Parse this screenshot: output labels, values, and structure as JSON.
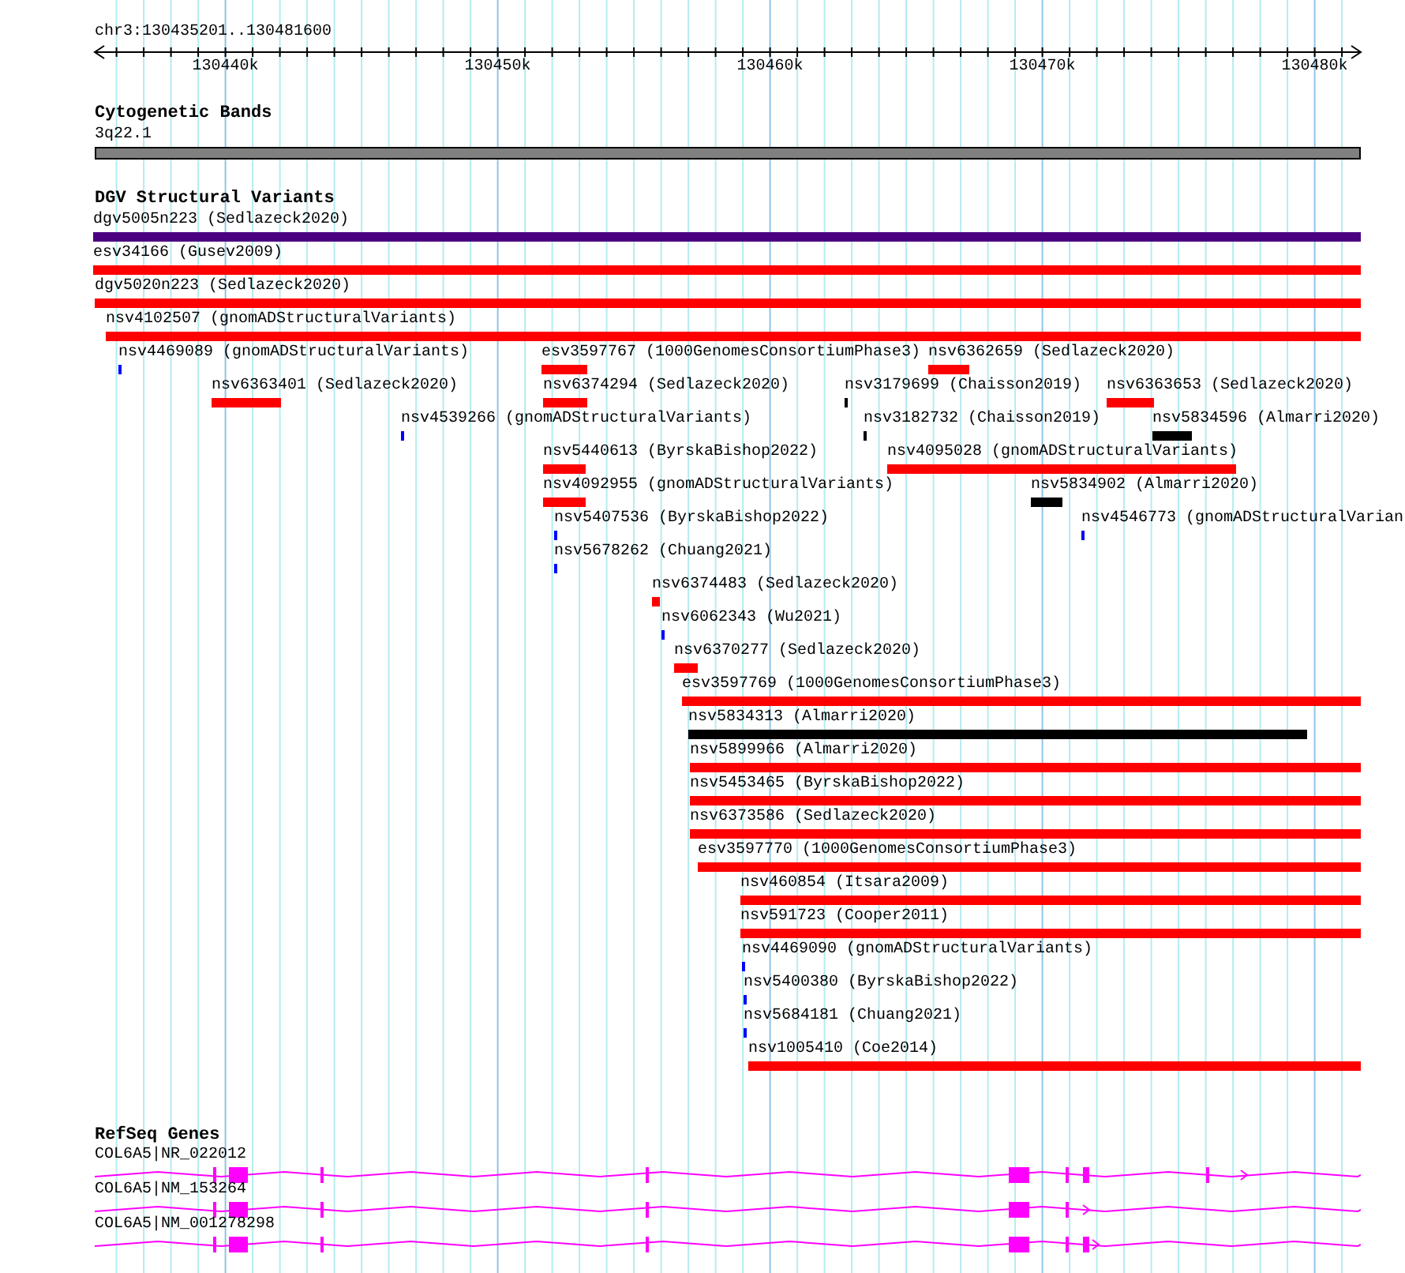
{
  "ruler": {
    "locus": "chr3:130435201..130481600",
    "ticks": [
      "130440k",
      "130450k",
      "130460k",
      "130470k",
      "130480k"
    ]
  },
  "cytogenetic_bands": {
    "title": "Cytogenetic Bands",
    "band": "3q22.1"
  },
  "dgv_structural_variants": {
    "title": "DGV Structural Variants",
    "rows": [
      {
        "features": [
          {
            "label": "dgv5005n223 (Sedlazeck2020)",
            "color": "#4b0082"
          }
        ]
      },
      {
        "features": [
          {
            "label": "esv34166 (Gusev2009)",
            "color": "#ff0000"
          }
        ]
      },
      {
        "features": [
          {
            "label": "dgv5020n223 (Sedlazeck2020)",
            "color": "#ff0000"
          }
        ]
      },
      {
        "features": [
          {
            "label": "nsv4102507 (gnomADStructuralVariants)",
            "color": "#ff0000"
          }
        ]
      },
      {
        "features": [
          {
            "label": "nsv4469089 (gnomADStructuralVariants)",
            "color": "#0000ff"
          },
          {
            "label": "esv3597767 (1000GenomesConsortiumPhase3)",
            "color": "#ff0000"
          },
          {
            "label": "nsv6362659 (Sedlazeck2020)",
            "color": "#ff0000"
          }
        ]
      },
      {
        "features": [
          {
            "label": "nsv6363401 (Sedlazeck2020)",
            "color": "#ff0000"
          },
          {
            "label": "nsv6374294 (Sedlazeck2020)",
            "color": "#ff0000"
          },
          {
            "label": "nsv3179699 (Chaisson2019)",
            "color": "#000000"
          },
          {
            "label": "nsv6363653 (Sedlazeck2020)",
            "color": "#ff0000"
          }
        ]
      },
      {
        "features": [
          {
            "label": "nsv4539266 (gnomADStructuralVariants)",
            "color": "#0000ff"
          },
          {
            "label": "nsv3182732 (Chaisson2019)",
            "color": "#000000"
          },
          {
            "label": "nsv5834596 (Almarri2020)",
            "color": "#000000"
          }
        ]
      },
      {
        "features": [
          {
            "label": "nsv5440613 (ByrskaBishop2022)",
            "color": "#ff0000"
          },
          {
            "label": "nsv4095028 (gnomADStructuralVariants)",
            "color": "#ff0000"
          }
        ]
      },
      {
        "features": [
          {
            "label": "nsv4092955 (gnomADStructuralVariants)",
            "color": "#ff0000"
          },
          {
            "label": "nsv5834902 (Almarri2020)",
            "color": "#000000"
          }
        ]
      },
      {
        "features": [
          {
            "label": "nsv5407536 (ByrskaBishop2022)",
            "color": "#0000ff"
          },
          {
            "label": "nsv4546773 (gnomADStructuralVarian",
            "color": "#0000ff"
          }
        ]
      },
      {
        "features": [
          {
            "label": "nsv5678262 (Chuang2021)",
            "color": "#0000ff"
          }
        ]
      },
      {
        "features": [
          {
            "label": "nsv6374483 (Sedlazeck2020)",
            "color": "#ff0000"
          }
        ]
      },
      {
        "features": [
          {
            "label": "nsv6062343 (Wu2021)",
            "color": "#0000ff"
          }
        ]
      },
      {
        "features": [
          {
            "label": "nsv6370277 (Sedlazeck2020)",
            "color": "#ff0000"
          }
        ]
      },
      {
        "features": [
          {
            "label": "esv3597769 (1000GenomesConsortiumPhase3)",
            "color": "#ff0000"
          }
        ]
      },
      {
        "features": [
          {
            "label": "nsv5834313 (Almarri2020)",
            "color": "#000000"
          }
        ]
      },
      {
        "features": [
          {
            "label": "nsv5899966 (Almarri2020)",
            "color": "#ff0000"
          }
        ]
      },
      {
        "features": [
          {
            "label": "nsv5453465 (ByrskaBishop2022)",
            "color": "#ff0000"
          }
        ]
      },
      {
        "features": [
          {
            "label": "nsv6373586 (Sedlazeck2020)",
            "color": "#ff0000"
          }
        ]
      },
      {
        "features": [
          {
            "label": "esv3597770 (1000GenomesConsortiumPhase3)",
            "color": "#ff0000"
          }
        ]
      },
      {
        "features": [
          {
            "label": "nsv460854 (Itsara2009)",
            "color": "#ff0000"
          }
        ]
      },
      {
        "features": [
          {
            "label": "nsv591723 (Cooper2011)",
            "color": "#ff0000"
          }
        ]
      },
      {
        "features": [
          {
            "label": "nsv4469090 (gnomADStructuralVariants)",
            "color": "#0000ff"
          }
        ]
      },
      {
        "features": [
          {
            "label": "nsv5400380 (ByrskaBishop2022)",
            "color": "#0000ff"
          }
        ]
      },
      {
        "features": [
          {
            "label": "nsv5684181 (Chuang2021)",
            "color": "#0000ff"
          }
        ]
      },
      {
        "features": [
          {
            "label": "nsv1005410 (Coe2014)",
            "color": "#ff0000"
          }
        ]
      }
    ]
  },
  "refseq_genes": {
    "title": "RefSeq Genes",
    "transcripts": [
      {
        "label": "COL6A5|NR_022012"
      },
      {
        "label": "COL6A5|NM_153264"
      },
      {
        "label": "COL6A5|NM_001278298"
      }
    ]
  }
}
